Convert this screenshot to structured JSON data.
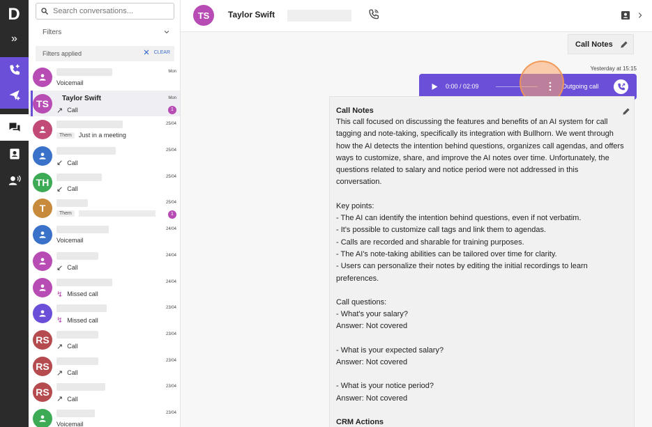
{
  "rail": {
    "logo": "D"
  },
  "list": {
    "search_placeholder": "Search conversations...",
    "filters_label": "Filters",
    "filters_applied": "Filters applied",
    "clear_label": "CLEAR",
    "items": [
      {
        "initials": "",
        "color": "#b84cb5",
        "blur_w": 80,
        "sub": "Voicemail",
        "arrow": "",
        "date": "Mon",
        "badge": ""
      },
      {
        "initials": "TS",
        "color": "#b84cb5",
        "name": "Taylor Swift",
        "sub": "Call",
        "arrow": "↗",
        "date": "Mon",
        "badge": "1"
      },
      {
        "initials": "",
        "color": "#c24a77",
        "blur_w": 95,
        "tag": "Them",
        "sub": "Just in a meeting",
        "arrow": "",
        "date": "25/04",
        "badge": ""
      },
      {
        "initials": "",
        "color": "#3b72c9",
        "blur_w": 85,
        "sub": "Call",
        "arrow": "↙",
        "date": "25/04",
        "badge": ""
      },
      {
        "initials": "TH",
        "color": "#3daa56",
        "blur_w": 65,
        "sub": "Call",
        "arrow": "↙",
        "date": "25/04",
        "badge": ""
      },
      {
        "initials": "T",
        "color": "#c88a3b",
        "blur_w": 45,
        "tag": "Them",
        "sub": "",
        "arrow": "",
        "date": "25/04",
        "badge": "1"
      },
      {
        "initials": "",
        "color": "#3b72c9",
        "blur_w": 75,
        "sub": "Voicemail",
        "arrow": "",
        "date": "24/04",
        "badge": ""
      },
      {
        "initials": "",
        "color": "#b84cb5",
        "blur_w": 60,
        "sub": "Call",
        "arrow": "↙",
        "date": "24/04",
        "badge": ""
      },
      {
        "initials": "",
        "color": "#b84cb5",
        "blur_w": 80,
        "sub": "Missed call",
        "arrow": "↯",
        "date": "24/04",
        "badge": ""
      },
      {
        "initials": "",
        "color": "#6b4fd8",
        "blur_w": 72,
        "sub": "Missed call",
        "arrow": "↯",
        "date": "23/04",
        "badge": ""
      },
      {
        "initials": "RS",
        "color": "#b54b4f",
        "blur_w": 60,
        "sub": "Call",
        "arrow": "↗",
        "date": "23/04",
        "badge": ""
      },
      {
        "initials": "RS",
        "color": "#b54b4f",
        "blur_w": 60,
        "sub": "Call",
        "arrow": "↗",
        "date": "23/04",
        "badge": ""
      },
      {
        "initials": "RS",
        "color": "#b54b4f",
        "blur_w": 70,
        "sub": "Call",
        "arrow": "↗",
        "date": "23/04",
        "badge": ""
      },
      {
        "initials": "",
        "color": "#3daa56",
        "blur_w": 55,
        "sub": "Voicemail",
        "arrow": "",
        "date": "23/04",
        "badge": ""
      }
    ]
  },
  "header": {
    "initials": "TS",
    "name": "Taylor Swift"
  },
  "main": {
    "call_notes_button": "Call Notes",
    "timestamp": "Yesterday at 15:15",
    "player": {
      "time": "0:00 / 02:09",
      "label": "Outgoing call"
    },
    "card": {
      "title": "Call Notes",
      "summary": "This call focused on discussing the features and benefits of an AI system for call tagging and note-taking, specifically its integration with Bullhorn. We went through how the AI detects the intention behind questions, organizes call agendas, and offers ways to customize, share, and improve the AI notes over time. Unfortunately, the questions related to salary and notice period were not addressed in this conversation.",
      "key_points_title": "Key points:",
      "key_points": [
        "- The AI can identify the intention behind questions, even if not verbatim.",
        "- It's possible to customize call tags and link them to agendas.",
        "- Calls are recorded and sharable for training purposes.",
        "- The AI's note-taking abilities can be tailored over time for clarity.",
        "- Users can personalize their notes by editing the initial recordings to learn preferences."
      ],
      "questions_title": "Call questions:",
      "q1": "- What's your salary?",
      "a1": "Answer: Not covered",
      "q2": "- What is your expected salary?",
      "a2": "Answer: Not covered",
      "q3": "- What is your notice period?",
      "a3": "Answer: Not covered",
      "crm_title": "CRM Actions"
    }
  }
}
